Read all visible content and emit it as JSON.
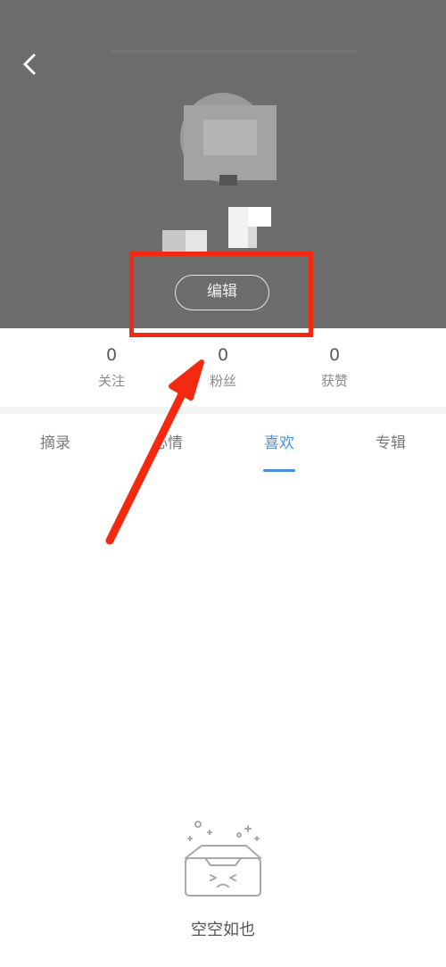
{
  "header": {
    "back_icon": "chevron-left-icon",
    "edit_label": "编辑"
  },
  "stats": [
    {
      "value": "0",
      "label": "关注"
    },
    {
      "value": "0",
      "label": "粉丝"
    },
    {
      "value": "0",
      "label": "获赞"
    }
  ],
  "tabs": [
    {
      "label": "摘录"
    },
    {
      "label": "心情"
    },
    {
      "label": "喜欢",
      "active": true
    },
    {
      "label": "专辑"
    }
  ],
  "empty_state": {
    "icon": "empty-box-icon",
    "text": "空空如也"
  },
  "colors": {
    "header_bg": "#6d6d6d",
    "accent": "#4a90e2",
    "annotation": "#f42a10"
  }
}
